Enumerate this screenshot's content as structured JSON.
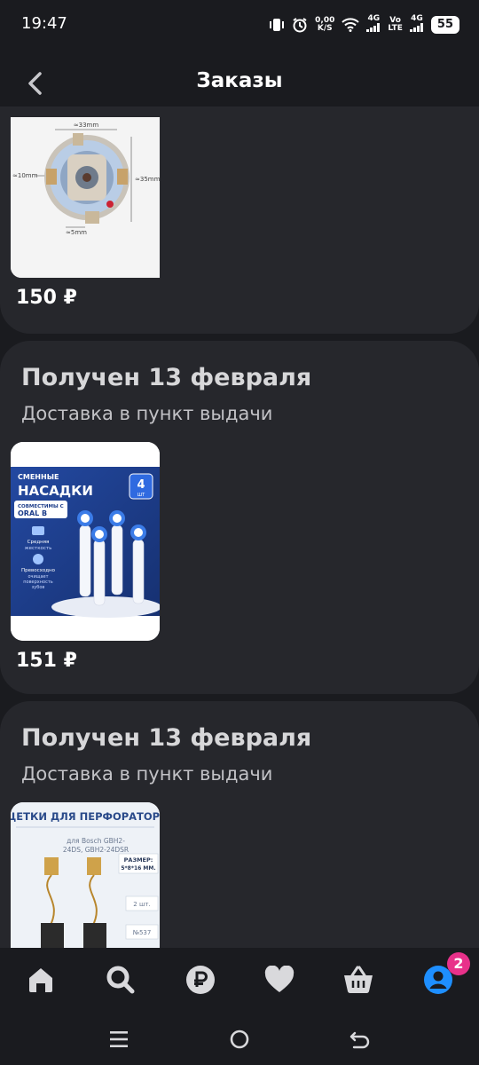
{
  "status_bar": {
    "time": "19:47",
    "speed_top": "0,00",
    "speed_bottom": "K/S",
    "net1_top": "4G",
    "net2_top": "Vo",
    "net2_bottom": "LTE",
    "net3_top": "4G",
    "battery": "55"
  },
  "header": {
    "title": "Заказы"
  },
  "orders": [
    {
      "price": "150 ₽",
      "image": {
        "dim_width": "≈33mm",
        "dim_height": "≈35mm",
        "dim_left": "≈10mm",
        "dim_bottom": "≈5mm"
      }
    },
    {
      "status": "Получен 13 февраля",
      "delivery": "Доставка в пункт выдачи",
      "price": "151 ₽",
      "image": {
        "line1": "СМЕННЫЕ",
        "line2": "НАСАДКИ",
        "count": "4",
        "count_unit": "ШТ",
        "compat_line1": "СОВМЕСТИМЫ С",
        "compat_line2": "ORAL B",
        "feature1_line1": "Средняя",
        "feature1_line2": "жесткость",
        "feature2_line1": "Превосходно",
        "feature2_line2": "очищает",
        "feature2_line3": "поверхность",
        "feature2_line4": "зубов"
      }
    },
    {
      "status": "Получен 13 февраля",
      "delivery": "Доставка в пункт выдачи",
      "image": {
        "title": "ЩЕТКИ ДЛЯ ПЕРФОРАТОРА",
        "sub1": "для Bosch GBH2-",
        "sub2": "24DS, GBH2-24DSR",
        "size_label": "РАЗМЕР:",
        "size_value": "5*8*16 ММ.",
        "qty": "2 шт.",
        "num": "№537"
      }
    }
  ],
  "bottom_nav": {
    "items": [
      "home-icon",
      "search-icon",
      "ruble-icon",
      "heart-icon",
      "basket-icon",
      "profile-icon"
    ],
    "profile_badge": "2",
    "active_color": "#1e8fff",
    "inactive_color": "#d9d9dc",
    "badge_color": "#e8318a"
  },
  "system_nav": [
    "menu-icon",
    "home-circle-icon",
    "back-arrow-icon"
  ]
}
